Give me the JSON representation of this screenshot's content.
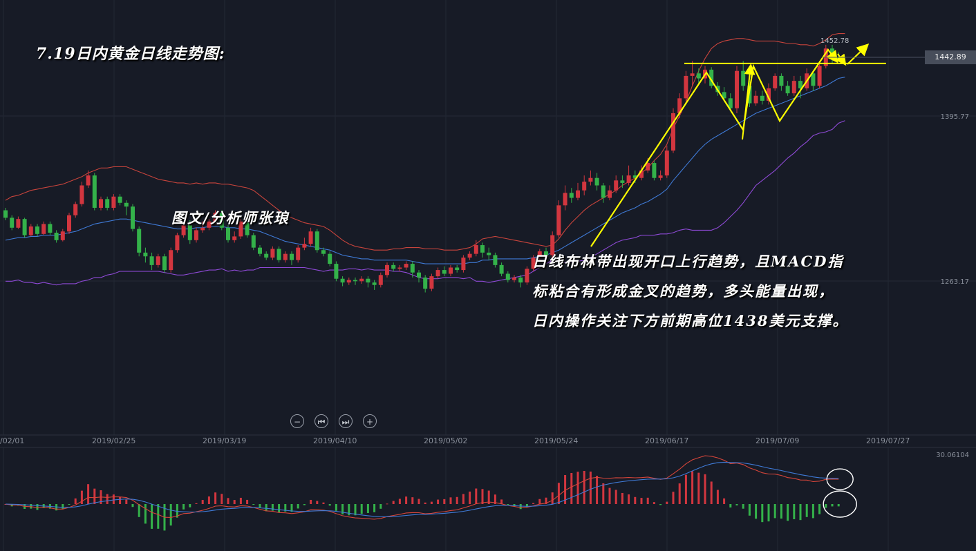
{
  "title": "7.19日内黄金日线走势图:",
  "author": "图文/分析师张琅",
  "analysis": [
    "日线布林带出现开口上行趋势，且MACD指",
    "标粘合有形成金叉的趋势，多头能量出现，",
    "日内操作关注下方前期高位1438美元支撑。"
  ],
  "controls": {
    "zoom_out": "−",
    "prev": "⏮",
    "next": "⏭",
    "zoom_in": "+"
  },
  "current_price": "1442.89",
  "chart_data": [
    {
      "type": "candlestick",
      "panel": "main",
      "price_labels": [
        "1452.78",
        "1395.77",
        "1263.17"
      ],
      "y_ticks": [
        1395.77,
        1263.17
      ],
      "peak_label": 1452.78,
      "current_price": 1442.89,
      "support_line": 1438,
      "date_ticks": [
        "/02/01",
        "2019/02/25",
        "2019/03/19",
        "2019/04/10",
        "2019/05/02",
        "2019/05/24",
        "2019/06/17",
        "2019/07/09",
        "2019/07/27"
      ],
      "candles": [
        [
          1320,
          1314,
          1312,
          1322
        ],
        [
          1314,
          1306,
          1304,
          1316
        ],
        [
          1306,
          1313,
          1305,
          1315
        ],
        [
          1313,
          1300,
          1298,
          1314
        ],
        [
          1300,
          1307,
          1299,
          1309
        ],
        [
          1307,
          1301,
          1299,
          1309
        ],
        [
          1301,
          1309,
          1300,
          1311
        ],
        [
          1309,
          1302,
          1300,
          1311
        ],
        [
          1302,
          1296,
          1294,
          1304
        ],
        [
          1296,
          1303,
          1295,
          1305
        ],
        [
          1303,
          1316,
          1301,
          1318
        ],
        [
          1316,
          1325,
          1314,
          1327
        ],
        [
          1325,
          1340,
          1323,
          1343
        ],
        [
          1340,
          1348,
          1338,
          1352
        ],
        [
          1348,
          1322,
          1320,
          1350
        ],
        [
          1322,
          1329,
          1320,
          1331
        ],
        [
          1329,
          1322,
          1320,
          1331
        ],
        [
          1322,
          1331,
          1320,
          1333
        ],
        [
          1331,
          1326,
          1324,
          1333
        ],
        [
          1326,
          1323,
          1316,
          1328
        ],
        [
          1323,
          1305,
          1303,
          1325
        ],
        [
          1305,
          1286,
          1283,
          1307
        ],
        [
          1286,
          1283,
          1278,
          1290
        ],
        [
          1283,
          1276,
          1272,
          1286
        ],
        [
          1276,
          1283,
          1274,
          1285
        ],
        [
          1283,
          1272,
          1270,
          1285
        ],
        [
          1272,
          1288,
          1270,
          1290
        ],
        [
          1288,
          1300,
          1286,
          1302
        ],
        [
          1300,
          1308,
          1298,
          1310
        ],
        [
          1308,
          1296,
          1293,
          1312
        ],
        [
          1296,
          1304,
          1294,
          1306
        ],
        [
          1304,
          1306,
          1302,
          1311
        ],
        [
          1306,
          1311,
          1304,
          1313
        ],
        [
          1311,
          1318,
          1309,
          1320
        ],
        [
          1318,
          1306,
          1304,
          1320
        ],
        [
          1306,
          1296,
          1294,
          1308
        ],
        [
          1296,
          1299,
          1294,
          1303
        ],
        [
          1299,
          1311,
          1297,
          1313
        ],
        [
          1311,
          1300,
          1298,
          1313
        ],
        [
          1300,
          1290,
          1288,
          1302
        ],
        [
          1290,
          1285,
          1283,
          1292
        ],
        [
          1285,
          1282,
          1280,
          1287
        ],
        [
          1282,
          1289,
          1280,
          1291
        ],
        [
          1289,
          1280,
          1278,
          1291
        ],
        [
          1280,
          1285,
          1278,
          1287
        ],
        [
          1285,
          1280,
          1276,
          1287
        ],
        [
          1280,
          1290,
          1278,
          1292
        ],
        [
          1290,
          1293,
          1288,
          1298
        ],
        [
          1293,
          1303,
          1291,
          1306
        ],
        [
          1303,
          1288,
          1286,
          1305
        ],
        [
          1288,
          1285,
          1283,
          1290
        ],
        [
          1285,
          1277,
          1275,
          1287
        ],
        [
          1277,
          1265,
          1263,
          1279
        ],
        [
          1265,
          1262,
          1259,
          1267
        ],
        [
          1262,
          1264,
          1260,
          1266
        ],
        [
          1264,
          1263,
          1260,
          1266
        ],
        [
          1263,
          1265,
          1261,
          1267
        ],
        [
          1265,
          1262,
          1258,
          1267
        ],
        [
          1262,
          1260,
          1256,
          1264
        ],
        [
          1260,
          1268,
          1258,
          1270
        ],
        [
          1268,
          1276,
          1266,
          1278
        ],
        [
          1276,
          1273,
          1271,
          1278
        ],
        [
          1273,
          1274,
          1271,
          1276
        ],
        [
          1274,
          1277,
          1272,
          1279
        ],
        [
          1277,
          1270,
          1266,
          1279
        ],
        [
          1270,
          1266,
          1262,
          1272
        ],
        [
          1266,
          1257,
          1254,
          1268
        ],
        [
          1257,
          1267,
          1255,
          1269
        ],
        [
          1267,
          1272,
          1265,
          1274
        ],
        [
          1272,
          1269,
          1267,
          1275
        ],
        [
          1269,
          1274,
          1267,
          1276
        ],
        [
          1274,
          1272,
          1270,
          1276
        ],
        [
          1272,
          1282,
          1270,
          1284
        ],
        [
          1282,
          1285,
          1280,
          1287
        ],
        [
          1285,
          1292,
          1283,
          1296
        ],
        [
          1292,
          1286,
          1282,
          1294
        ],
        [
          1286,
          1284,
          1280,
          1290
        ],
        [
          1284,
          1276,
          1274,
          1286
        ],
        [
          1276,
          1269,
          1267,
          1278
        ],
        [
          1269,
          1264,
          1262,
          1271
        ],
        [
          1264,
          1266,
          1262,
          1268
        ],
        [
          1266,
          1262,
          1258,
          1268
        ],
        [
          1262,
          1273,
          1260,
          1275
        ],
        [
          1273,
          1282,
          1271,
          1284
        ],
        [
          1282,
          1287,
          1280,
          1289
        ],
        [
          1287,
          1284,
          1280,
          1290
        ],
        [
          1284,
          1300,
          1282,
          1303
        ],
        [
          1300,
          1324,
          1298,
          1328
        ],
        [
          1324,
          1334,
          1320,
          1340
        ],
        [
          1334,
          1330,
          1326,
          1338
        ],
        [
          1330,
          1336,
          1328,
          1342
        ],
        [
          1336,
          1343,
          1332,
          1348
        ],
        [
          1343,
          1346,
          1340,
          1352
        ],
        [
          1346,
          1340,
          1336,
          1350
        ],
        [
          1340,
          1330,
          1326,
          1342
        ],
        [
          1330,
          1336,
          1328,
          1340
        ],
        [
          1336,
          1344,
          1334,
          1348
        ],
        [
          1344,
          1342,
          1338,
          1348
        ],
        [
          1342,
          1348,
          1340,
          1356
        ],
        [
          1348,
          1346,
          1342,
          1352
        ],
        [
          1346,
          1352,
          1344,
          1356
        ],
        [
          1352,
          1358,
          1350,
          1362
        ],
        [
          1358,
          1346,
          1344,
          1360
        ],
        [
          1346,
          1348,
          1344,
          1352
        ],
        [
          1348,
          1368,
          1346,
          1372
        ],
        [
          1368,
          1398,
          1366,
          1402
        ],
        [
          1398,
          1410,
          1394,
          1414
        ],
        [
          1410,
          1428,
          1408,
          1432
        ],
        [
          1428,
          1430,
          1420,
          1440
        ],
        [
          1430,
          1426,
          1422,
          1434
        ],
        [
          1426,
          1433,
          1422,
          1436
        ],
        [
          1433,
          1420,
          1418,
          1435
        ],
        [
          1420,
          1415,
          1412,
          1423
        ],
        [
          1415,
          1410,
          1408,
          1419
        ],
        [
          1410,
          1402,
          1400,
          1414
        ],
        [
          1402,
          1432,
          1398,
          1436
        ],
        [
          1432,
          1420,
          1416,
          1440
        ],
        [
          1420,
          1406,
          1403,
          1424
        ],
        [
          1406,
          1412,
          1404,
          1416
        ],
        [
          1412,
          1408,
          1405,
          1416
        ],
        [
          1408,
          1418,
          1405,
          1422
        ],
        [
          1418,
          1428,
          1416,
          1430
        ],
        [
          1428,
          1420,
          1416,
          1430
        ],
        [
          1420,
          1414,
          1412,
          1424
        ],
        [
          1414,
          1424,
          1412,
          1428
        ],
        [
          1424,
          1418,
          1410,
          1428
        ],
        [
          1418,
          1430,
          1416,
          1434
        ],
        [
          1430,
          1420,
          1416,
          1432
        ],
        [
          1420,
          1436,
          1418,
          1440
        ],
        [
          1436,
          1450,
          1434,
          1453
        ],
        [
          1450,
          1443,
          1438,
          1453
        ],
        [
          1443,
          1442,
          1440,
          1447
        ]
      ],
      "bollinger": {
        "upper": [
          1328,
          1331,
          1332,
          1334,
          1336,
          1337,
          1338,
          1339,
          1340,
          1341,
          1343,
          1345,
          1347,
          1350,
          1352,
          1354,
          1354,
          1355,
          1355,
          1355,
          1353,
          1351,
          1349,
          1347,
          1345,
          1344,
          1343,
          1342,
          1342,
          1341,
          1342,
          1341,
          1342,
          1342,
          1341,
          1341,
          1340,
          1339,
          1338,
          1336,
          1332,
          1328,
          1324,
          1320,
          1316,
          1314,
          1312,
          1310,
          1309,
          1308,
          1307,
          1304,
          1300,
          1296,
          1293,
          1291,
          1290,
          1289,
          1288,
          1288,
          1288,
          1289,
          1289,
          1290,
          1290,
          1290,
          1289,
          1289,
          1289,
          1288,
          1288,
          1288,
          1289,
          1290,
          1293,
          1297,
          1298,
          1299,
          1298,
          1297,
          1296,
          1295,
          1294,
          1293,
          1292,
          1291,
          1292,
          1297,
          1304,
          1310,
          1315,
          1320,
          1324,
          1327,
          1330,
          1333,
          1336,
          1340,
          1343,
          1346,
          1350,
          1354,
          1360,
          1365,
          1373,
          1386,
          1396,
          1407,
          1420,
          1432,
          1442,
          1450,
          1454,
          1456,
          1457,
          1458,
          1458,
          1457,
          1456,
          1456,
          1456,
          1456,
          1455,
          1454,
          1454,
          1453,
          1453,
          1452,
          1454,
          1457,
          1461,
          1462,
          1462
        ],
        "middle": [
          1296,
          1297,
          1298,
          1298,
          1299,
          1299,
          1300,
          1300,
          1300,
          1301,
          1302,
          1303,
          1305,
          1307,
          1309,
          1310,
          1311,
          1312,
          1313,
          1313,
          1312,
          1311,
          1310,
          1309,
          1308,
          1307,
          1306,
          1305,
          1305,
          1305,
          1306,
          1306,
          1307,
          1307,
          1307,
          1306,
          1306,
          1305,
          1305,
          1304,
          1303,
          1301,
          1299,
          1297,
          1295,
          1294,
          1293,
          1292,
          1291,
          1290,
          1289,
          1288,
          1286,
          1284,
          1283,
          1282,
          1281,
          1281,
          1280,
          1280,
          1280,
          1280,
          1280,
          1280,
          1279,
          1278,
          1277,
          1277,
          1277,
          1277,
          1277,
          1277,
          1277,
          1278,
          1278,
          1280,
          1280,
          1281,
          1281,
          1281,
          1281,
          1281,
          1281,
          1282,
          1283,
          1284,
          1286,
          1288,
          1291,
          1294,
          1297,
          1300,
          1303,
          1306,
          1309,
          1312,
          1315,
          1318,
          1320,
          1322,
          1325,
          1327,
          1330,
          1333,
          1337,
          1344,
          1350,
          1356,
          1362,
          1368,
          1373,
          1377,
          1380,
          1383,
          1386,
          1389,
          1392,
          1395,
          1398,
          1400,
          1402,
          1404,
          1406,
          1408,
          1410,
          1412,
          1414,
          1416,
          1418,
          1420,
          1423,
          1426,
          1427
        ],
        "lower": [
          1263,
          1263,
          1264,
          1262,
          1262,
          1261,
          1262,
          1261,
          1260,
          1261,
          1261,
          1261,
          1263,
          1264,
          1266,
          1266,
          1268,
          1269,
          1271,
          1271,
          1271,
          1271,
          1271,
          1271,
          1271,
          1270,
          1269,
          1268,
          1268,
          1269,
          1270,
          1271,
          1272,
          1272,
          1273,
          1271,
          1272,
          1271,
          1272,
          1272,
          1274,
          1274,
          1274,
          1274,
          1274,
          1274,
          1274,
          1274,
          1273,
          1272,
          1271,
          1272,
          1272,
          1272,
          1273,
          1273,
          1272,
          1273,
          1272,
          1272,
          1272,
          1271,
          1271,
          1270,
          1268,
          1266,
          1265,
          1265,
          1265,
          1266,
          1266,
          1266,
          1265,
          1266,
          1263,
          1263,
          1262,
          1263,
          1264,
          1265,
          1266,
          1267,
          1268,
          1271,
          1274,
          1277,
          1280,
          1279,
          1278,
          1278,
          1279,
          1280,
          1282,
          1285,
          1288,
          1291,
          1294,
          1296,
          1297,
          1298,
          1300,
          1300,
          1300,
          1301,
          1301,
          1302,
          1304,
          1305,
          1304,
          1304,
          1304,
          1304,
          1306,
          1310,
          1315,
          1320,
          1326,
          1333,
          1340,
          1344,
          1348,
          1352,
          1357,
          1362,
          1366,
          1371,
          1375,
          1380,
          1382,
          1383,
          1385,
          1390,
          1392
        ]
      },
      "colors": {
        "up": "#d2363f",
        "down": "#34b24a",
        "upper": "#c8443c",
        "middle": "#3f7ad6",
        "lower": "#8e4ad6",
        "support": "#ffff00",
        "arrows": "#ffff00"
      }
    },
    {
      "type": "macd",
      "panel": "lower",
      "value_label": "30.06104",
      "colors": {
        "dif": "#d6453a",
        "dea": "#3f7ad6",
        "positive": "#d2363f",
        "negative": "#34b24a"
      }
    }
  ]
}
